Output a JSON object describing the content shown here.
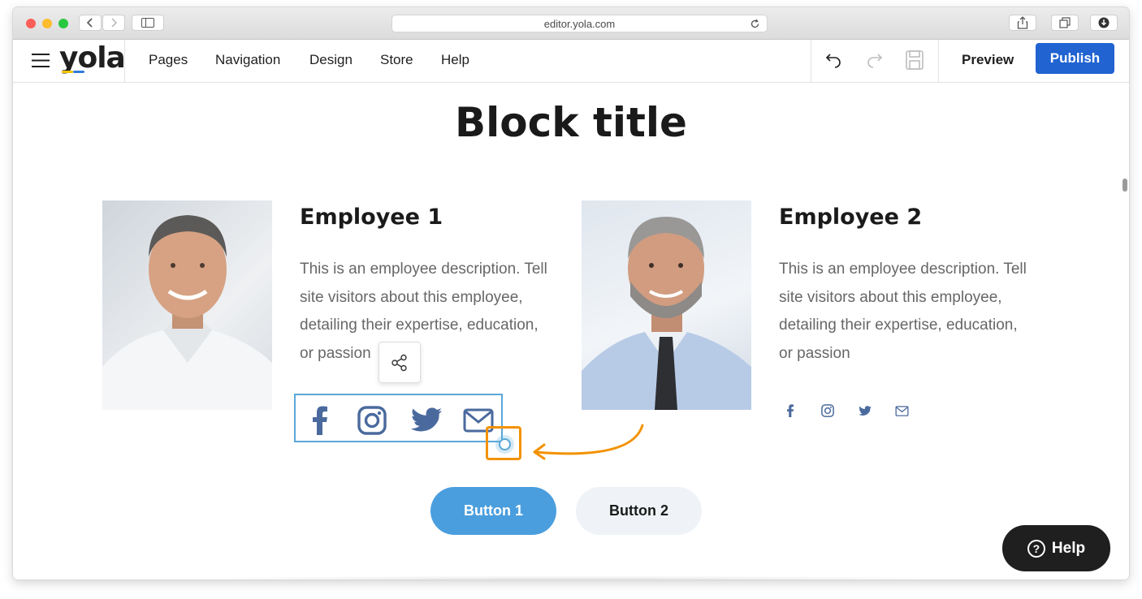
{
  "browser": {
    "url": "editor.yola.com"
  },
  "app": {
    "logo_text": "yola",
    "nav": [
      "Pages",
      "Navigation",
      "Design",
      "Store",
      "Help"
    ],
    "preview_label": "Preview",
    "publish_label": "Publish"
  },
  "page": {
    "block_title": "Block title",
    "employees": [
      {
        "name": "Employee 1",
        "description_lines": [
          "This is an employee description. Tell",
          "site visitors about this employee,",
          "detailing their expertise, education,",
          "or passion"
        ]
      },
      {
        "name": "Employee 2",
        "description_lines": [
          "This is an employee description. Tell",
          "site visitors about this employee,",
          "detailing their expertise, education,",
          "or passion"
        ]
      }
    ],
    "buttons": {
      "button1": "Button 1",
      "button2": "Button 2"
    },
    "social_icons": [
      "facebook-icon",
      "instagram-icon",
      "twitter-icon",
      "mail-icon"
    ]
  },
  "help_widget": {
    "label": "Help"
  },
  "colors": {
    "publish": "#2063d1",
    "button1": "#4a9ede",
    "button2": "#eff3f7",
    "social": "#4a6a9e",
    "highlight": "#f39200",
    "selection": "#5aa8d8",
    "help_bg": "#1f1f1f"
  }
}
